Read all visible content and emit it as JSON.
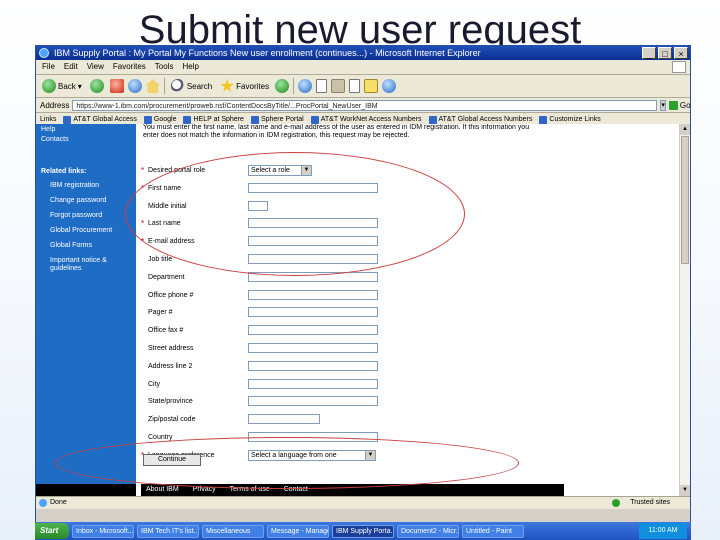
{
  "slide": {
    "title": "Submit new user request"
  },
  "window": {
    "title": "IBM Supply Portal : My Portal My Functions New user enrollment (continues...) - Microsoft Internet Explorer",
    "controls": [
      "_",
      "□",
      "×"
    ]
  },
  "menubar": [
    "File",
    "Edit",
    "View",
    "Favorites",
    "Tools",
    "Help"
  ],
  "toolbar": {
    "back": "Back",
    "search": "Search",
    "favorites": "Favorites"
  },
  "addressbar": {
    "label": "Address",
    "url": "https://www-1.ibm.com/procurement/proweb.nsf/ContentDocsByTitle/...ProcPortal_NewUser_IBM",
    "go": "Go"
  },
  "linksbar": {
    "label": "Links",
    "items": [
      "AT&T Global Access",
      "Google",
      "HELP at Sphere",
      "Sphere Portal",
      "AT&T WorkNet Access Numbers",
      "AT&T Global Access Numbers",
      "Customize Links"
    ]
  },
  "sidebar": {
    "top_items": [
      "Help",
      "Contacts"
    ],
    "related_heading": "Related links:",
    "related_items": [
      "IBM registration",
      "Change password",
      "Forgot password",
      "Global Procurement",
      "Global Forms",
      "Important notice & guidelines"
    ]
  },
  "form": {
    "intro": "You must enter the first name, last name and e-mail address of the user as entered in IDM registration. If this information you enter does not match the information in IDM registration, this request may be rejected.",
    "fields": [
      {
        "label": "Desired portal role",
        "required": true,
        "type": "select",
        "value": "Select a role"
      },
      {
        "label": "First name",
        "required": true,
        "type": "text"
      },
      {
        "label": "Middle initial",
        "required": false,
        "type": "text-short"
      },
      {
        "label": "Last name",
        "required": true,
        "type": "text"
      },
      {
        "label": "E-mail address",
        "required": true,
        "type": "text"
      },
      {
        "label": "Job title",
        "required": false,
        "type": "text"
      },
      {
        "label": "Department",
        "required": false,
        "type": "text"
      },
      {
        "label": "Office phone #",
        "required": false,
        "type": "text"
      },
      {
        "label": "Pager #",
        "required": false,
        "type": "text"
      },
      {
        "label": "Office fax #",
        "required": false,
        "type": "text"
      },
      {
        "label": "Street address",
        "required": false,
        "type": "text"
      },
      {
        "label": "Address line 2",
        "required": false,
        "type": "text"
      },
      {
        "label": "City",
        "required": false,
        "type": "text"
      },
      {
        "label": "State/province",
        "required": false,
        "type": "text"
      },
      {
        "label": "Zip/postal code",
        "required": false,
        "type": "text-medium"
      },
      {
        "label": "Country",
        "required": false,
        "type": "text"
      },
      {
        "label": "Language preference",
        "required": true,
        "type": "select-wide",
        "value": "Select a language from one"
      }
    ],
    "continue_label": "Continue"
  },
  "footer": {
    "items": [
      "About IBM",
      "Privacy",
      "Terms of use",
      "Contact"
    ]
  },
  "statusbar": {
    "left": "Done",
    "right": "Trusted sites"
  },
  "taskbar": {
    "start": "Start",
    "tasks": [
      "Inbox - Microsoft...",
      "IBM Tech IT's list...",
      "Miscellaneous",
      "Message - Manage...",
      "IBM Supply Porta...",
      "Document2 - Micr...",
      "Untitled - Paint"
    ],
    "active_index": 4,
    "clock": "11:00 AM"
  }
}
